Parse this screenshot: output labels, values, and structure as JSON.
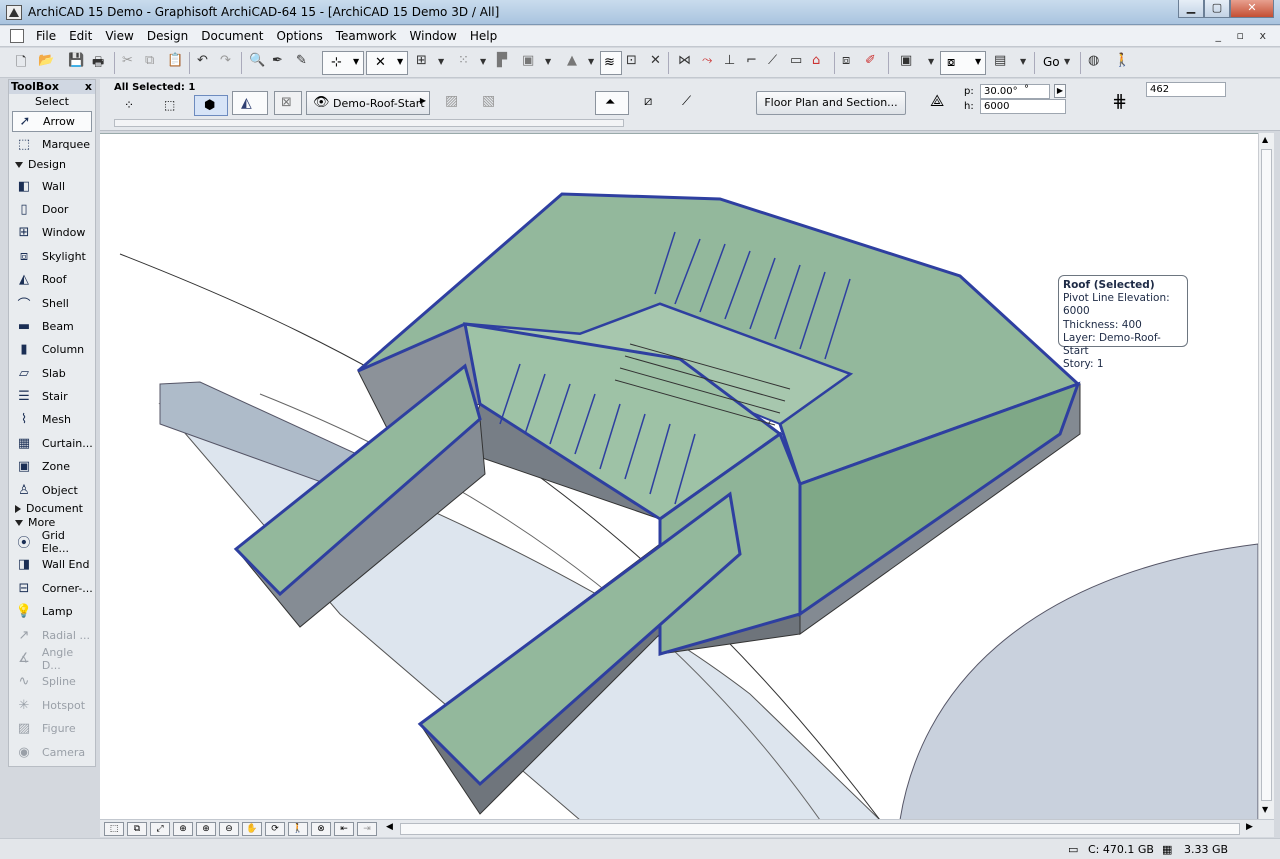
{
  "window": {
    "title": "ArchiCAD 15 Demo - Graphisoft ArchiCAD-64 15 - [ArchiCAD 15 Demo 3D / All]",
    "controls": {
      "minimize": "▁",
      "maximize": "▢",
      "close": "✕"
    }
  },
  "menu": {
    "items": [
      "File",
      "Edit",
      "View",
      "Design",
      "Document",
      "Options",
      "Teamwork",
      "Window",
      "Help"
    ],
    "mdi_controls": "_ ▫ x"
  },
  "toolbar": {
    "go_label": "Go"
  },
  "infobox": {
    "selection_label": "All Selected: 1",
    "layer_name": "Demo-Roof-Start",
    "floor_plan_button": "Floor Plan and Section...",
    "pitch_label": "p:",
    "pitch_value": "30.00°",
    "pitch_unit": "°",
    "height_label": "h:",
    "height_value": "6000",
    "thickness_value": "462"
  },
  "toolbox": {
    "header": "ToolBox",
    "close": "x",
    "select_section": "Select",
    "select_tools": [
      {
        "label": "Arrow",
        "icon": "arrow-icon",
        "selected": true
      },
      {
        "label": "Marquee",
        "icon": "marquee-icon"
      }
    ],
    "design_group": "Design",
    "design_tools": [
      {
        "label": "Wall",
        "icon": "wall-icon"
      },
      {
        "label": "Door",
        "icon": "door-icon"
      },
      {
        "label": "Window",
        "icon": "window-icon"
      },
      {
        "label": "Skylight",
        "icon": "skylight-icon"
      },
      {
        "label": "Roof",
        "icon": "roof-icon"
      },
      {
        "label": "Shell",
        "icon": "shell-icon"
      },
      {
        "label": "Beam",
        "icon": "beam-icon"
      },
      {
        "label": "Column",
        "icon": "column-icon"
      },
      {
        "label": "Slab",
        "icon": "slab-icon"
      },
      {
        "label": "Stair",
        "icon": "stair-icon"
      },
      {
        "label": "Mesh",
        "icon": "mesh-icon"
      },
      {
        "label": "Curtain...",
        "icon": "curtain-wall-icon"
      },
      {
        "label": "Zone",
        "icon": "zone-icon"
      },
      {
        "label": "Object",
        "icon": "object-icon"
      }
    ],
    "document_group": "Document",
    "more_group": "More",
    "more_tools": [
      {
        "label": "Grid Ele...",
        "icon": "grid-element-icon",
        "dim": false
      },
      {
        "label": "Wall End",
        "icon": "wall-end-icon",
        "dim": false
      },
      {
        "label": "Corner-...",
        "icon": "corner-window-icon",
        "dim": false
      },
      {
        "label": "Lamp",
        "icon": "lamp-icon",
        "dim": false
      },
      {
        "label": "Radial ...",
        "icon": "radial-dimension-icon",
        "dim": true
      },
      {
        "label": "Angle D...",
        "icon": "angle-dimension-icon",
        "dim": true
      },
      {
        "label": "Spline",
        "icon": "spline-icon",
        "dim": true
      },
      {
        "label": "Hotspot",
        "icon": "hotspot-icon",
        "dim": true
      },
      {
        "label": "Figure",
        "icon": "figure-icon",
        "dim": true
      },
      {
        "label": "Camera",
        "icon": "camera-icon",
        "dim": true
      }
    ]
  },
  "tooltip": {
    "title": "Roof (Selected)",
    "lines": [
      "Pivot Line Elevation: 6000",
      "Thickness: 400",
      "Layer: Demo-Roof-Start",
      "Story: 1"
    ]
  },
  "status": {
    "disk": "C: 470.1 GB",
    "memory": "3.33 GB"
  },
  "colors": {
    "roof_fill": "#93b89c",
    "roof_outline": "#2e3fa0",
    "wall_shade": "#8a9097",
    "ground": "#b9c3cf",
    "accent": "#3b5998"
  }
}
